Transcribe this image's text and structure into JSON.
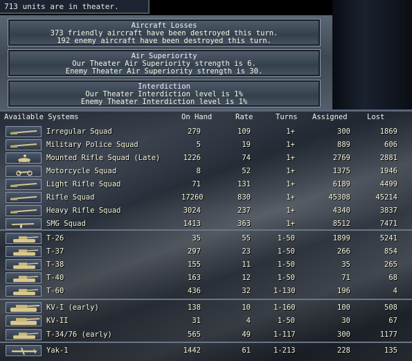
{
  "topbar": {
    "text": "713 units are in theater."
  },
  "reports": {
    "aircraft_losses": {
      "title": "Aircraft Losses",
      "line1": "373 friendly aircraft have been destroyed this turn.",
      "line2": "192 enemy aircraft have been destroyed this turn."
    },
    "air_superiority": {
      "title": "Air Superiority",
      "line1": "Our Theater Air Superiority strength is 6.",
      "line2": "Enemy Theater Air Superiority strength is 30."
    },
    "interdiction": {
      "title": "Interdiction",
      "line1": "Our Theater Interdiction level is 1%",
      "line2": "Enemy Theater Interdiction level is 1%"
    }
  },
  "table": {
    "headers": {
      "systems": "Available Systems",
      "on_hand": "On Hand",
      "rate": "Rate",
      "turns": "Turns",
      "assigned": "Assigned",
      "lost": "Lost"
    },
    "rows": [
      {
        "name": "Irregular Squad",
        "on_hand": "279",
        "rate": "109",
        "turns": "1+",
        "assigned": "300",
        "lost": "1869",
        "icon": "rifle-icon"
      },
      {
        "name": "Military Police Squad",
        "on_hand": "5",
        "rate": "19",
        "turns": "1+",
        "assigned": "889",
        "lost": "606",
        "icon": "rifle-icon"
      },
      {
        "name": "Mounted Rifle Squad (Late)",
        "on_hand": "1226",
        "rate": "74",
        "turns": "1+",
        "assigned": "2769",
        "lost": "2881",
        "icon": "horse-rider-icon"
      },
      {
        "name": "Motorcycle Squad",
        "on_hand": "8",
        "rate": "52",
        "turns": "1+",
        "assigned": "1375",
        "lost": "1946",
        "icon": "motorcycle-icon"
      },
      {
        "name": "Light Rifle Squad",
        "on_hand": "71",
        "rate": "131",
        "turns": "1+",
        "assigned": "6189",
        "lost": "4499",
        "icon": "rifle-icon"
      },
      {
        "name": "Rifle Squad",
        "on_hand": "17260",
        "rate": "830",
        "turns": "1+",
        "assigned": "45308",
        "lost": "45214",
        "icon": "rifle-icon"
      },
      {
        "name": "Heavy Rifle Squad",
        "on_hand": "3024",
        "rate": "237",
        "turns": "1+",
        "assigned": "4340",
        "lost": "3837",
        "icon": "rifle-icon"
      },
      {
        "name": "SMG Squad",
        "on_hand": "1413",
        "rate": "363",
        "turns": "1+",
        "assigned": "8512",
        "lost": "7471",
        "icon": "smg-icon"
      },
      {
        "name": "T-26",
        "on_hand": "35",
        "rate": "55",
        "turns": "1-50",
        "assigned": "1899",
        "lost": "5241",
        "icon": "tank-icon"
      },
      {
        "name": "T-37",
        "on_hand": "297",
        "rate": "23",
        "turns": "1-50",
        "assigned": "266",
        "lost": "854",
        "icon": "tank-icon"
      },
      {
        "name": "T-38",
        "on_hand": "155",
        "rate": "11",
        "turns": "1-50",
        "assigned": "35",
        "lost": "265",
        "icon": "tank-icon"
      },
      {
        "name": "T-40",
        "on_hand": "163",
        "rate": "12",
        "turns": "1-50",
        "assigned": "71",
        "lost": "68",
        "icon": "tank-icon"
      },
      {
        "name": "T-60",
        "on_hand": "436",
        "rate": "32",
        "turns": "1-130",
        "assigned": "196",
        "lost": "4",
        "icon": "tank-icon"
      },
      {
        "name": "KV-I (early)",
        "on_hand": "138",
        "rate": "10",
        "turns": "1-160",
        "assigned": "100",
        "lost": "508",
        "icon": "heavy-tank-icon"
      },
      {
        "name": "KV-II",
        "on_hand": "31",
        "rate": "4",
        "turns": "1-50",
        "assigned": "30",
        "lost": "67",
        "icon": "heavy-tank-icon"
      },
      {
        "name": "T-34/76 (early)",
        "on_hand": "565",
        "rate": "49",
        "turns": "1-117",
        "assigned": "300",
        "lost": "1177",
        "icon": "tank-icon"
      },
      {
        "name": "Yak-1",
        "on_hand": "1442",
        "rate": "61",
        "turns": "1-213",
        "assigned": "228",
        "lost": "135",
        "icon": "fighter-plane-icon"
      }
    ]
  }
}
